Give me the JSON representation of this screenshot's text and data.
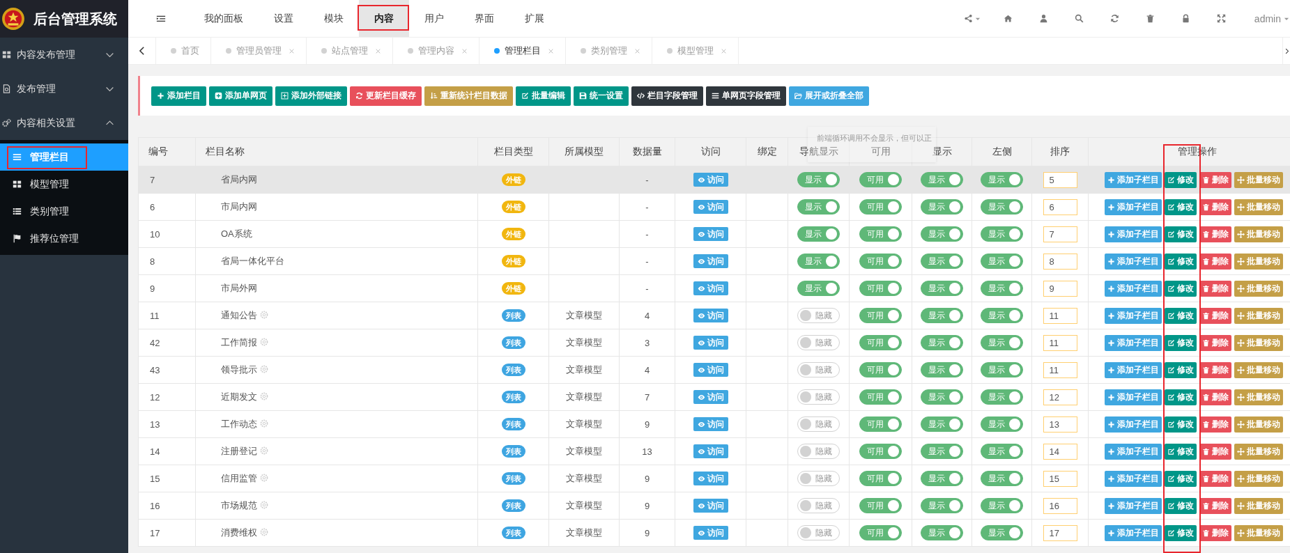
{
  "app": {
    "title": "后台管理系统"
  },
  "topnav": {
    "items": [
      {
        "label": "我的面板",
        "selected": false,
        "highlighted": false
      },
      {
        "label": "设置",
        "selected": false,
        "highlighted": false
      },
      {
        "label": "模块",
        "selected": false,
        "highlighted": false
      },
      {
        "label": "内容",
        "selected": true,
        "highlighted": true
      },
      {
        "label": "用户",
        "selected": false,
        "highlighted": false
      },
      {
        "label": "界面",
        "selected": false,
        "highlighted": false
      },
      {
        "label": "扩展",
        "selected": false,
        "highlighted": false
      }
    ],
    "user": "admin"
  },
  "sidebar": {
    "menus": [
      {
        "label": "内容发布管理",
        "expanded": false
      },
      {
        "label": "发布管理",
        "expanded": false
      },
      {
        "label": "内容相关设置",
        "expanded": true,
        "children": [
          {
            "label": "管理栏目",
            "selected": true,
            "highlighted": true
          },
          {
            "label": "模型管理",
            "selected": false,
            "highlighted": false
          },
          {
            "label": "类别管理",
            "selected": false,
            "highlighted": false
          },
          {
            "label": "推荐位管理",
            "selected": false,
            "highlighted": false
          }
        ]
      }
    ]
  },
  "tabs": [
    {
      "label": "首页",
      "selected": false,
      "closable": false
    },
    {
      "label": "管理员管理",
      "selected": false,
      "closable": true
    },
    {
      "label": "站点管理",
      "selected": false,
      "closable": true
    },
    {
      "label": "管理内容",
      "selected": false,
      "closable": true
    },
    {
      "label": "管理栏目",
      "selected": true,
      "closable": true
    },
    {
      "label": "类别管理",
      "selected": false,
      "closable": true
    },
    {
      "label": "模型管理",
      "selected": false,
      "closable": true
    }
  ],
  "toolbar": [
    {
      "label": "添加栏目",
      "kind": "add"
    },
    {
      "label": "添加单网页",
      "kind": "add-page"
    },
    {
      "label": "添加外部链接",
      "kind": "add-link"
    },
    {
      "label": "更新栏目缓存",
      "kind": "refresh-cache"
    },
    {
      "label": "重新统计栏目数据",
      "kind": "recount"
    },
    {
      "label": "批量编辑",
      "kind": "batch-edit"
    },
    {
      "label": "统一设置",
      "kind": "unify"
    },
    {
      "label": "栏目字段管理",
      "kind": "fields"
    },
    {
      "label": "单网页字段管理",
      "kind": "page-fields"
    },
    {
      "label": "展开或折叠全部",
      "kind": "toggle-all"
    }
  ],
  "table": {
    "columns": [
      "编号",
      "栏目名称",
      "栏目类型",
      "所属模型",
      "数据量",
      "访问",
      "绑定",
      "导航显示",
      "可用",
      "显示",
      "左侧",
      "排序",
      "管理操作"
    ],
    "tooltip": "前端循环调用不会显示，但可以正",
    "edit_column_highlighted": true,
    "rows": [
      {
        "id": "7",
        "name": "省局内网",
        "gear": false,
        "type": {
          "label": "外链",
          "kind": "link"
        },
        "count": "-",
        "visit": "访问",
        "switches": [
          {
            "label": "显示",
            "on": true
          },
          {
            "label": "可用",
            "on": true
          },
          {
            "label": "显示",
            "on": true
          },
          {
            "label": "显示",
            "on": true
          }
        ],
        "order": "5",
        "hover": true,
        "actions": [
          {
            "label": "添加子栏目",
            "kind": "add-child"
          },
          {
            "label": "修改",
            "kind": "edit"
          },
          {
            "label": "删除",
            "kind": "delete"
          },
          {
            "label": "批量移动",
            "kind": "move"
          }
        ]
      },
      {
        "id": "6",
        "name": "市局内网",
        "gear": false,
        "type": {
          "label": "外链",
          "kind": "link"
        },
        "count": "-",
        "visit": "访问",
        "switches": [
          {
            "label": "显示",
            "on": true
          },
          {
            "label": "可用",
            "on": true
          },
          {
            "label": "显示",
            "on": true
          },
          {
            "label": "显示",
            "on": true
          }
        ],
        "order": "6",
        "hover": false,
        "actions": [
          {
            "label": "添加子栏目",
            "kind": "add-child"
          },
          {
            "label": "修改",
            "kind": "edit"
          },
          {
            "label": "删除",
            "kind": "delete"
          },
          {
            "label": "批量移动",
            "kind": "move"
          }
        ]
      },
      {
        "id": "10",
        "name": "OA系统",
        "gear": false,
        "type": {
          "label": "外链",
          "kind": "link"
        },
        "count": "-",
        "visit": "访问",
        "switches": [
          {
            "label": "显示",
            "on": true
          },
          {
            "label": "可用",
            "on": true
          },
          {
            "label": "显示",
            "on": true
          },
          {
            "label": "显示",
            "on": true
          }
        ],
        "order": "7",
        "hover": false,
        "actions": [
          {
            "label": "添加子栏目",
            "kind": "add-child"
          },
          {
            "label": "修改",
            "kind": "edit"
          },
          {
            "label": "删除",
            "kind": "delete"
          },
          {
            "label": "批量移动",
            "kind": "move"
          }
        ]
      },
      {
        "id": "8",
        "name": "省局一体化平台",
        "gear": false,
        "type": {
          "label": "外链",
          "kind": "link"
        },
        "count": "-",
        "visit": "访问",
        "switches": [
          {
            "label": "显示",
            "on": true
          },
          {
            "label": "可用",
            "on": true
          },
          {
            "label": "显示",
            "on": true
          },
          {
            "label": "显示",
            "on": true
          }
        ],
        "order": "8",
        "hover": false,
        "actions": [
          {
            "label": "添加子栏目",
            "kind": "add-child"
          },
          {
            "label": "修改",
            "kind": "edit"
          },
          {
            "label": "删除",
            "kind": "delete"
          },
          {
            "label": "批量移动",
            "kind": "move"
          }
        ]
      },
      {
        "id": "9",
        "name": "市局外网",
        "gear": false,
        "type": {
          "label": "外链",
          "kind": "link"
        },
        "count": "-",
        "visit": "访问",
        "switches": [
          {
            "label": "显示",
            "on": true
          },
          {
            "label": "可用",
            "on": true
          },
          {
            "label": "显示",
            "on": true
          },
          {
            "label": "显示",
            "on": true
          }
        ],
        "order": "9",
        "hover": false,
        "actions": [
          {
            "label": "添加子栏目",
            "kind": "add-child"
          },
          {
            "label": "修改",
            "kind": "edit"
          },
          {
            "label": "删除",
            "kind": "delete"
          },
          {
            "label": "批量移动",
            "kind": "move"
          }
        ]
      },
      {
        "id": "11",
        "name": "通知公告",
        "gear": true,
        "type": {
          "label": "列表",
          "kind": "list"
        },
        "model": "文章模型",
        "count": "4",
        "visit": "访问",
        "switches": [
          {
            "label": "隐藏",
            "on": false
          },
          {
            "label": "可用",
            "on": true
          },
          {
            "label": "显示",
            "on": true
          },
          {
            "label": "显示",
            "on": true
          }
        ],
        "order": "11",
        "hover": false,
        "actions": [
          {
            "label": "添加子栏目",
            "kind": "add-child"
          },
          {
            "label": "修改",
            "kind": "edit"
          },
          {
            "label": "删除",
            "kind": "delete"
          },
          {
            "label": "批量移动",
            "kind": "move"
          }
        ]
      },
      {
        "id": "42",
        "name": "工作简报",
        "gear": true,
        "type": {
          "label": "列表",
          "kind": "list"
        },
        "model": "文章模型",
        "count": "3",
        "visit": "访问",
        "switches": [
          {
            "label": "隐藏",
            "on": false
          },
          {
            "label": "可用",
            "on": true
          },
          {
            "label": "显示",
            "on": true
          },
          {
            "label": "显示",
            "on": true
          }
        ],
        "order": "11",
        "hover": false,
        "actions": [
          {
            "label": "添加子栏目",
            "kind": "add-child"
          },
          {
            "label": "修改",
            "kind": "edit"
          },
          {
            "label": "删除",
            "kind": "delete"
          },
          {
            "label": "批量移动",
            "kind": "move"
          }
        ]
      },
      {
        "id": "43",
        "name": "领导批示",
        "gear": true,
        "type": {
          "label": "列表",
          "kind": "list"
        },
        "model": "文章模型",
        "count": "4",
        "visit": "访问",
        "switches": [
          {
            "label": "隐藏",
            "on": false
          },
          {
            "label": "可用",
            "on": true
          },
          {
            "label": "显示",
            "on": true
          },
          {
            "label": "显示",
            "on": true
          }
        ],
        "order": "11",
        "hover": false,
        "actions": [
          {
            "label": "添加子栏目",
            "kind": "add-child"
          },
          {
            "label": "修改",
            "kind": "edit"
          },
          {
            "label": "删除",
            "kind": "delete"
          },
          {
            "label": "批量移动",
            "kind": "move"
          }
        ]
      },
      {
        "id": "12",
        "name": "近期发文",
        "gear": true,
        "type": {
          "label": "列表",
          "kind": "list"
        },
        "model": "文章模型",
        "count": "7",
        "visit": "访问",
        "switches": [
          {
            "label": "隐藏",
            "on": false
          },
          {
            "label": "可用",
            "on": true
          },
          {
            "label": "显示",
            "on": true
          },
          {
            "label": "显示",
            "on": true
          }
        ],
        "order": "12",
        "hover": false,
        "actions": [
          {
            "label": "添加子栏目",
            "kind": "add-child"
          },
          {
            "label": "修改",
            "kind": "edit"
          },
          {
            "label": "删除",
            "kind": "delete"
          },
          {
            "label": "批量移动",
            "kind": "move"
          }
        ]
      },
      {
        "id": "13",
        "name": "工作动态",
        "gear": true,
        "type": {
          "label": "列表",
          "kind": "list"
        },
        "model": "文章模型",
        "count": "9",
        "visit": "访问",
        "switches": [
          {
            "label": "隐藏",
            "on": false
          },
          {
            "label": "可用",
            "on": true
          },
          {
            "label": "显示",
            "on": true
          },
          {
            "label": "显示",
            "on": true
          }
        ],
        "order": "13",
        "hover": false,
        "actions": [
          {
            "label": "添加子栏目",
            "kind": "add-child"
          },
          {
            "label": "修改",
            "kind": "edit"
          },
          {
            "label": "删除",
            "kind": "delete"
          },
          {
            "label": "批量移动",
            "kind": "move"
          }
        ]
      },
      {
        "id": "14",
        "name": "注册登记",
        "gear": true,
        "type": {
          "label": "列表",
          "kind": "list"
        },
        "model": "文章模型",
        "count": "13",
        "visit": "访问",
        "switches": [
          {
            "label": "隐藏",
            "on": false
          },
          {
            "label": "可用",
            "on": true
          },
          {
            "label": "显示",
            "on": true
          },
          {
            "label": "显示",
            "on": true
          }
        ],
        "order": "14",
        "hover": false,
        "actions": [
          {
            "label": "添加子栏目",
            "kind": "add-child"
          },
          {
            "label": "修改",
            "kind": "edit"
          },
          {
            "label": "删除",
            "kind": "delete"
          },
          {
            "label": "批量移动",
            "kind": "move"
          }
        ]
      },
      {
        "id": "15",
        "name": "信用监管",
        "gear": true,
        "type": {
          "label": "列表",
          "kind": "list"
        },
        "model": "文章模型",
        "count": "9",
        "visit": "访问",
        "switches": [
          {
            "label": "隐藏",
            "on": false
          },
          {
            "label": "可用",
            "on": true
          },
          {
            "label": "显示",
            "on": true
          },
          {
            "label": "显示",
            "on": true
          }
        ],
        "order": "15",
        "hover": false,
        "actions": [
          {
            "label": "添加子栏目",
            "kind": "add-child"
          },
          {
            "label": "修改",
            "kind": "edit"
          },
          {
            "label": "删除",
            "kind": "delete"
          },
          {
            "label": "批量移动",
            "kind": "move"
          }
        ]
      },
      {
        "id": "16",
        "name": "市场规范",
        "gear": true,
        "type": {
          "label": "列表",
          "kind": "list"
        },
        "model": "文章模型",
        "count": "9",
        "visit": "访问",
        "switches": [
          {
            "label": "隐藏",
            "on": false
          },
          {
            "label": "可用",
            "on": true
          },
          {
            "label": "显示",
            "on": true
          },
          {
            "label": "显示",
            "on": true
          }
        ],
        "order": "16",
        "hover": false,
        "actions": [
          {
            "label": "添加子栏目",
            "kind": "add-child"
          },
          {
            "label": "修改",
            "kind": "edit"
          },
          {
            "label": "删除",
            "kind": "delete"
          },
          {
            "label": "批量移动",
            "kind": "move"
          }
        ]
      },
      {
        "id": "17",
        "name": "消费维权",
        "gear": true,
        "type": {
          "label": "列表",
          "kind": "list"
        },
        "model": "文章模型",
        "count": "9",
        "visit": "访问",
        "switches": [
          {
            "label": "隐藏",
            "on": false
          },
          {
            "label": "可用",
            "on": true
          },
          {
            "label": "显示",
            "on": true
          },
          {
            "label": "显示",
            "on": true
          }
        ],
        "order": "17",
        "hover": false,
        "actions": [
          {
            "label": "添加子栏目",
            "kind": "add-child"
          },
          {
            "label": "修改",
            "kind": "edit"
          },
          {
            "label": "删除",
            "kind": "delete"
          },
          {
            "label": "批量移动",
            "kind": "move"
          }
        ]
      }
    ]
  }
}
